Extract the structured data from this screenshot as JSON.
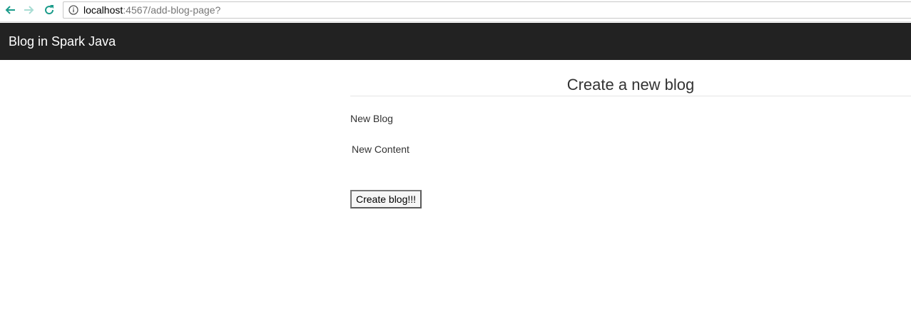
{
  "browser": {
    "url_host": "localhost",
    "url_path": ":4567/add-blog-page?",
    "icons": {
      "back": "arrow-left-icon",
      "forward": "arrow-right-icon",
      "reload": "reload-icon",
      "info": "info-icon"
    },
    "colors": {
      "nav_active": "#1a9b8a",
      "nav_disabled": "#a8dcd3"
    }
  },
  "navbar": {
    "brand": "Blog in Spark Java",
    "background": "#222222"
  },
  "main": {
    "title": "Create a new blog",
    "fields": {
      "blog_label": "New Blog",
      "content_label": "New Content"
    },
    "submit_label": "Create blog!!!"
  }
}
